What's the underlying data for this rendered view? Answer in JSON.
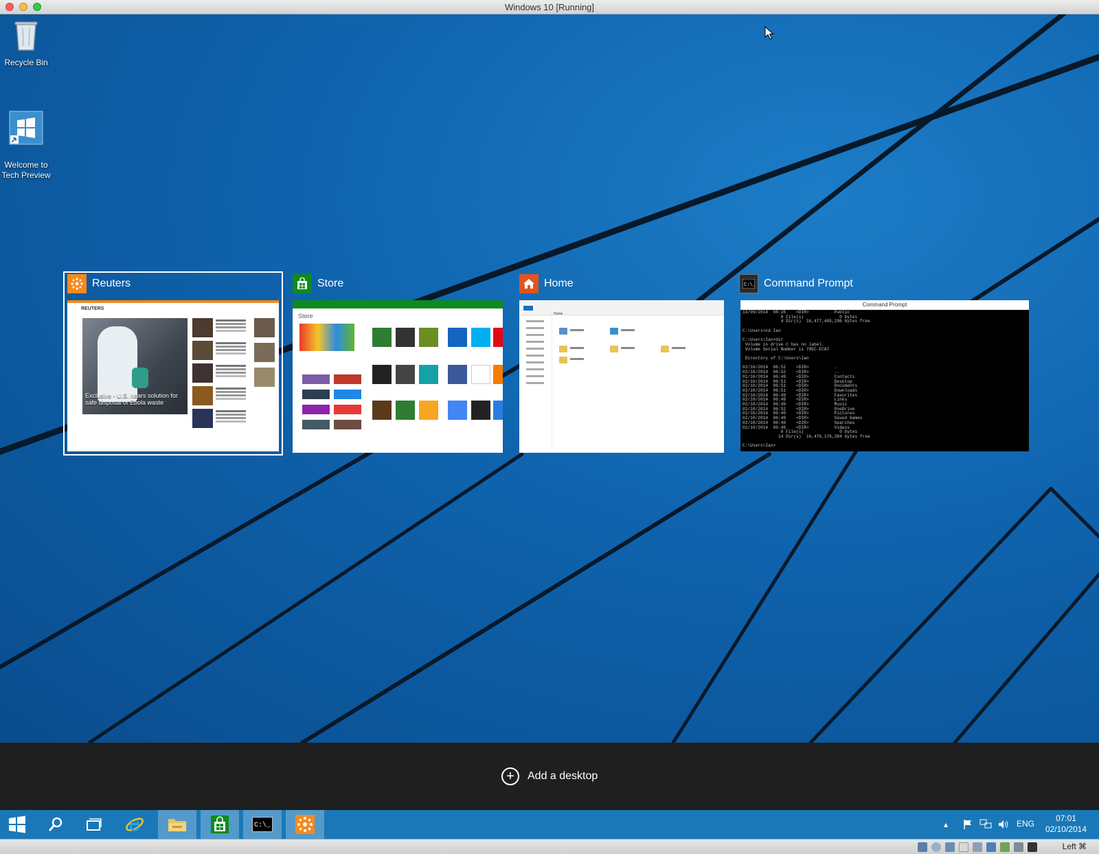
{
  "window": {
    "title": "Windows 10 [Running]"
  },
  "desktop_icons": [
    {
      "label": "Recycle Bin",
      "icon": "recycle-bin-icon"
    },
    {
      "label": "Welcome to\nTech Preview",
      "icon": "windows-shortcut-icon"
    }
  ],
  "task_view": {
    "windows": [
      {
        "title": "Reuters",
        "icon": "reuters-icon",
        "accent": "#f58a1f",
        "selected": true,
        "preview": {
          "brand": "REUTERS",
          "headline": "Exclusive - U.S. nears solution for safe disposal of Ebola waste"
        }
      },
      {
        "title": "Store",
        "icon": "store-bag-icon",
        "accent": "#0d8b1e",
        "preview": {
          "heading": "Store"
        }
      },
      {
        "title": "Home",
        "icon": "home-icon",
        "accent": "#e0541f",
        "preview": {
          "location": "Home"
        }
      },
      {
        "title": "Command Prompt",
        "icon": "cmd-icon",
        "accent": "#000000",
        "preview": {
          "window_title": "Command Prompt",
          "lines": [
            "13/09/2014  08:26    <DIR>          Public",
            "               0 File(s)              0 bytes",
            "               4 Dir(s)  16,477,495,296 bytes free",
            "",
            "C:\\Users>cd Ian",
            "",
            "C:\\Users\\Ian>dir",
            " Volume in drive C has no label.",
            " Volume Serial Number is 70EC-ECA7",
            "",
            " Directory of C:\\Users\\Ian",
            "",
            "02/10/2014  06:52    <DIR>          .",
            "02/10/2014  06:52    <DIR>          ..",
            "02/10/2014  06:49    <DIR>          Contacts",
            "02/10/2014  06:51    <DIR>          Desktop",
            "02/10/2014  06:51    <DIR>          Documents",
            "02/10/2014  06:51    <DIR>          Downloads",
            "02/10/2014  06:49    <DIR>          Favorites",
            "02/10/2014  06:49    <DIR>          Links",
            "02/10/2014  06:49    <DIR>          Music",
            "02/10/2014  06:52    <DIR>          OneDrive",
            "02/10/2014  06:49    <DIR>          Pictures",
            "02/10/2014  06:49    <DIR>          Saved Games",
            "02/10/2014  06:49    <DIR>          Searches",
            "02/10/2014  06:49    <DIR>          Videos",
            "               0 File(s)              0 bytes",
            "              14 Dir(s)  16,476,176,384 bytes free",
            "",
            "C:\\Users\\Ian>"
          ]
        }
      }
    ],
    "add_desktop_label": "Add a desktop"
  },
  "taskbar": {
    "buttons": [
      {
        "name": "start",
        "icon": "windows-start-icon"
      },
      {
        "name": "search",
        "icon": "search-icon"
      },
      {
        "name": "task-view",
        "icon": "task-view-icon"
      },
      {
        "name": "internet-explorer",
        "icon": "internet-explorer-icon"
      },
      {
        "name": "file-explorer",
        "icon": "file-explorer-icon"
      },
      {
        "name": "store",
        "icon": "store-bag-icon"
      },
      {
        "name": "command-prompt",
        "icon": "cmd-icon"
      },
      {
        "name": "reuters",
        "icon": "reuters-icon"
      }
    ],
    "tray": {
      "language": "ENG",
      "time": "07:01",
      "date": "02/10/2014"
    }
  },
  "vbox_status": {
    "host_key": "Left ⌘"
  },
  "colors": {
    "desktop_blue": "#0f63ad",
    "taskbar": "#1a78b8",
    "task_bar_dark": "#1f1f1f"
  }
}
